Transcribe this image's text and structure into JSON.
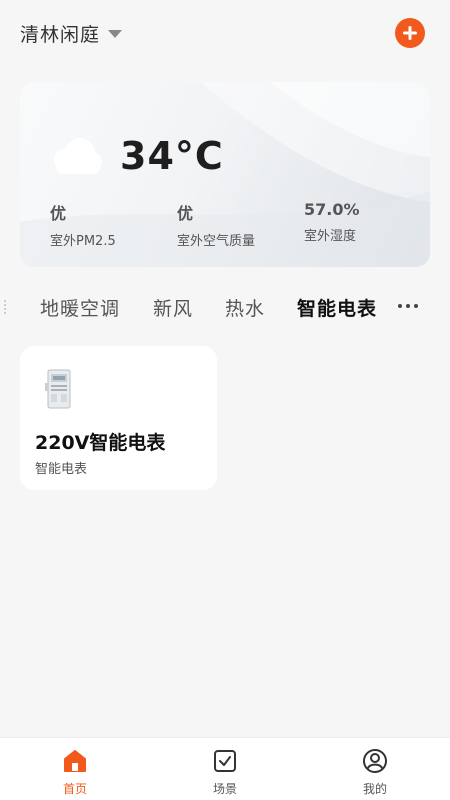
{
  "header": {
    "home_name": "清林闲庭"
  },
  "weather": {
    "temperature": "34°C",
    "metrics": [
      {
        "value": "优",
        "label": "室外PM2.5"
      },
      {
        "value": "优",
        "label": "室外空气质量"
      },
      {
        "value": "57.0%",
        "label": "室外湿度"
      }
    ]
  },
  "tabs": [
    {
      "label": "地暖空调"
    },
    {
      "label": "新风"
    },
    {
      "label": "热水"
    },
    {
      "label": "智能电表",
      "active": true
    }
  ],
  "devices": [
    {
      "name": "220V智能电表",
      "type": "智能电表"
    }
  ],
  "bottom_nav": [
    {
      "label": "首页",
      "icon": "home-icon",
      "active": true
    },
    {
      "label": "场景",
      "icon": "checkbox-icon"
    },
    {
      "label": "我的",
      "icon": "profile-icon"
    }
  ],
  "colors": {
    "accent": "#f25a1d",
    "background": "#f6f6f6"
  }
}
